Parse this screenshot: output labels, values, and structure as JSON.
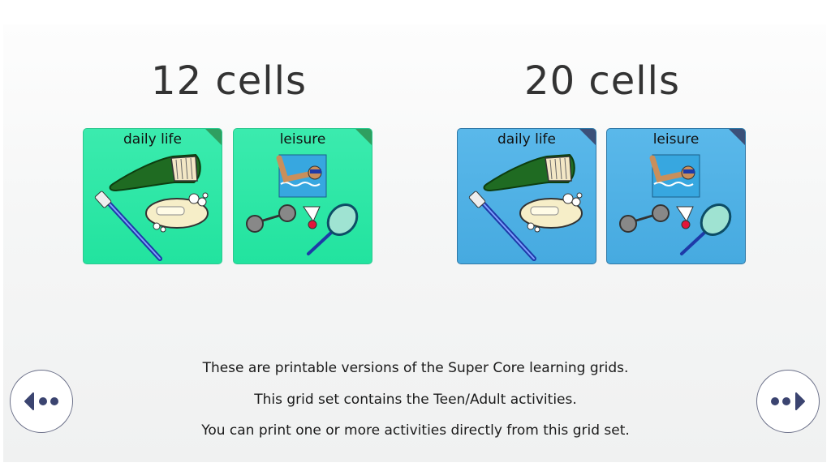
{
  "sections": [
    {
      "heading": "12 cells",
      "tiles": [
        {
          "label": "daily life"
        },
        {
          "label": "leisure"
        }
      ]
    },
    {
      "heading": "20 cells",
      "tiles": [
        {
          "label": "daily life"
        },
        {
          "label": "leisure"
        }
      ]
    }
  ],
  "info": {
    "line1": "These are printable versions of the Super Core learning grids.",
    "line2": "This grid set contains the Teen/Adult activities.",
    "line3": "You can print one or more activities directly from this grid set."
  },
  "icons": {
    "prev": "previous-arrow-icon",
    "next": "next-arrow-icon"
  },
  "colors": {
    "green_tile": "#2ae6a4",
    "blue_tile": "#50b1e5",
    "nav_accent": "#3b4470"
  }
}
